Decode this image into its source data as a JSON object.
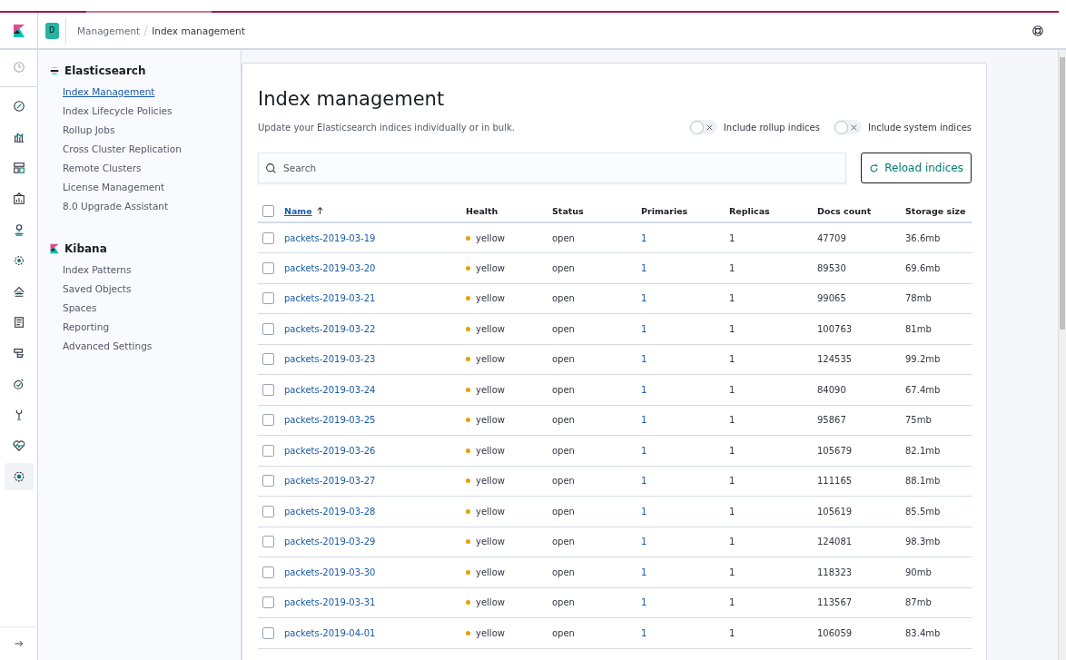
{
  "header": {
    "space_badge": "D",
    "breadcrumbs": [
      "Management",
      "Index management"
    ]
  },
  "nav_rail": {
    "items": [
      {
        "selected": false
      },
      {
        "selected": false
      },
      {
        "selected": false
      },
      {
        "selected": false
      },
      {
        "selected": false
      },
      {
        "selected": false
      },
      {
        "selected": false
      },
      {
        "selected": false
      },
      {
        "selected": false
      },
      {
        "selected": false
      },
      {
        "selected": false
      },
      {
        "selected": false
      },
      {
        "selected": false
      },
      {
        "selected": true
      }
    ]
  },
  "sidebar": {
    "sections": [
      {
        "title": "Elasticsearch",
        "items": [
          {
            "label": "Index Management",
            "selected": true
          },
          {
            "label": "Index Lifecycle Policies",
            "selected": false
          },
          {
            "label": "Rollup Jobs",
            "selected": false
          },
          {
            "label": "Cross Cluster Replication",
            "selected": false
          },
          {
            "label": "Remote Clusters",
            "selected": false
          },
          {
            "label": "License Management",
            "selected": false
          },
          {
            "label": "8.0 Upgrade Assistant",
            "selected": false
          }
        ]
      },
      {
        "title": "Kibana",
        "items": [
          {
            "label": "Index Patterns",
            "selected": false
          },
          {
            "label": "Saved Objects",
            "selected": false
          },
          {
            "label": "Spaces",
            "selected": false
          },
          {
            "label": "Reporting",
            "selected": false
          },
          {
            "label": "Advanced Settings",
            "selected": false
          }
        ]
      }
    ]
  },
  "page": {
    "title": "Index management",
    "description": "Update your Elasticsearch indices individually or in bulk.",
    "toggles": [
      {
        "label": "Include rollup indices",
        "on": false
      },
      {
        "label": "Include system indices",
        "on": false
      }
    ],
    "search": {
      "placeholder": "Search"
    },
    "reload_button": "Reload indices"
  },
  "table": {
    "select_all_checked": false,
    "columns": [
      {
        "label": "Name",
        "sorted": true
      },
      {
        "label": "Health",
        "sorted": false
      },
      {
        "label": "Status",
        "sorted": false
      },
      {
        "label": "Primaries",
        "sorted": false
      },
      {
        "label": "Replicas",
        "sorted": false
      },
      {
        "label": "Docs count",
        "sorted": false
      },
      {
        "label": "Storage size",
        "sorted": false
      }
    ],
    "rows": [
      {
        "name": "packets-2019-03-19",
        "health": "yellow",
        "color": "#e7a100",
        "status": "open",
        "primaries": "1",
        "replicas": "1",
        "docs": "47709",
        "size": "36.6mb",
        "checked": false
      },
      {
        "name": "packets-2019-03-20",
        "health": "yellow",
        "color": "#e7a100",
        "status": "open",
        "primaries": "1",
        "replicas": "1",
        "docs": "89530",
        "size": "69.6mb",
        "checked": false
      },
      {
        "name": "packets-2019-03-21",
        "health": "yellow",
        "color": "#e7a100",
        "status": "open",
        "primaries": "1",
        "replicas": "1",
        "docs": "99065",
        "size": "78mb",
        "checked": false
      },
      {
        "name": "packets-2019-03-22",
        "health": "yellow",
        "color": "#e7a100",
        "status": "open",
        "primaries": "1",
        "replicas": "1",
        "docs": "100763",
        "size": "81mb",
        "checked": false
      },
      {
        "name": "packets-2019-03-23",
        "health": "yellow",
        "color": "#e7a100",
        "status": "open",
        "primaries": "1",
        "replicas": "1",
        "docs": "124535",
        "size": "99.2mb",
        "checked": false
      },
      {
        "name": "packets-2019-03-24",
        "health": "yellow",
        "color": "#e7a100",
        "status": "open",
        "primaries": "1",
        "replicas": "1",
        "docs": "84090",
        "size": "67.4mb",
        "checked": false
      },
      {
        "name": "packets-2019-03-25",
        "health": "yellow",
        "color": "#e7a100",
        "status": "open",
        "primaries": "1",
        "replicas": "1",
        "docs": "95867",
        "size": "75mb",
        "checked": false
      },
      {
        "name": "packets-2019-03-26",
        "health": "yellow",
        "color": "#e7a100",
        "status": "open",
        "primaries": "1",
        "replicas": "1",
        "docs": "105679",
        "size": "82.1mb",
        "checked": false
      },
      {
        "name": "packets-2019-03-27",
        "health": "yellow",
        "color": "#e7a100",
        "status": "open",
        "primaries": "1",
        "replicas": "1",
        "docs": "111165",
        "size": "88.1mb",
        "checked": false
      },
      {
        "name": "packets-2019-03-28",
        "health": "yellow",
        "color": "#e7a100",
        "status": "open",
        "primaries": "1",
        "replicas": "1",
        "docs": "105619",
        "size": "85.5mb",
        "checked": false
      },
      {
        "name": "packets-2019-03-29",
        "health": "yellow",
        "color": "#e7a100",
        "status": "open",
        "primaries": "1",
        "replicas": "1",
        "docs": "124081",
        "size": "98.3mb",
        "checked": false
      },
      {
        "name": "packets-2019-03-30",
        "health": "yellow",
        "color": "#e7a100",
        "status": "open",
        "primaries": "1",
        "replicas": "1",
        "docs": "118323",
        "size": "90mb",
        "checked": false
      },
      {
        "name": "packets-2019-03-31",
        "health": "yellow",
        "color": "#e7a100",
        "status": "open",
        "primaries": "1",
        "replicas": "1",
        "docs": "113567",
        "size": "87mb",
        "checked": false
      },
      {
        "name": "packets-2019-04-01",
        "health": "yellow",
        "color": "#e7a100",
        "status": "open",
        "primaries": "1",
        "replicas": "1",
        "docs": "106059",
        "size": "83.4mb",
        "checked": false
      }
    ]
  }
}
